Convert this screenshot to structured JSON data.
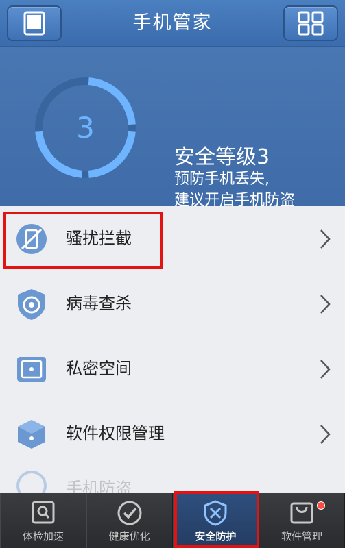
{
  "header": {
    "title": "手机管家",
    "left_icon": "phone-icon",
    "right_icon": "grid-icon"
  },
  "status": {
    "level": "3",
    "level_fraction": 0.75,
    "title": "安全等级3",
    "desc_line1": "预防手机丢失,",
    "desc_line2": "建议开启手机防盗"
  },
  "menu": {
    "items": [
      {
        "label": "骚扰拦截",
        "icon": "block-phone-icon"
      },
      {
        "label": "病毒查杀",
        "icon": "virus-shield-icon"
      },
      {
        "label": "私密空间",
        "icon": "safe-icon"
      },
      {
        "label": "软件权限管理",
        "icon": "cube-icon"
      },
      {
        "label": "手机防盗",
        "icon": "antitheft-icon"
      }
    ]
  },
  "tabs": [
    {
      "label": "体检加速",
      "icon": "scan-icon"
    },
    {
      "label": "健康优化",
      "icon": "check-icon"
    },
    {
      "label": "安全防护",
      "icon": "shield-icon"
    },
    {
      "label": "软件管理",
      "icon": "bag-icon"
    }
  ],
  "colors": {
    "header": "#3f72b5",
    "banner": "#4472ad",
    "ring": "#6fb4ff",
    "highlight": "#e11313",
    "badge": "#ff4c3d"
  }
}
